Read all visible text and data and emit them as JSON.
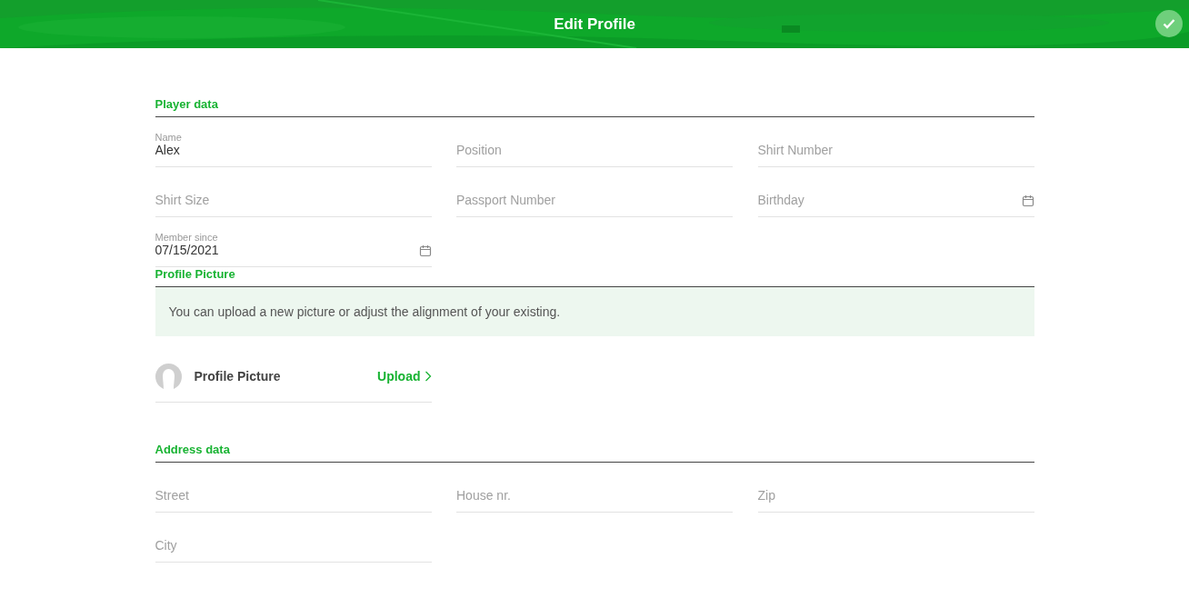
{
  "header": {
    "title": "Edit Profile"
  },
  "sections": [
    {
      "kind": "fields",
      "title": "Player data",
      "fields": [
        {
          "kind": "text",
          "label": "Name",
          "value": "Alex"
        },
        {
          "kind": "text",
          "placeholder": "Position"
        },
        {
          "kind": "text",
          "placeholder": "Shirt Number"
        },
        {
          "kind": "text",
          "placeholder": "Shirt Size"
        },
        {
          "kind": "text",
          "placeholder": "Passport Number"
        },
        {
          "kind": "date",
          "placeholder": "Birthday"
        },
        {
          "kind": "date",
          "label": "Member since",
          "value": "07/15/2021"
        }
      ]
    },
    {
      "kind": "picture",
      "title": "Profile Picture",
      "note": "You can upload a new picture or adjust the alignment of your existing.",
      "label": "Profile Picture",
      "action": "Upload"
    },
    {
      "kind": "fields",
      "title": "Address data",
      "fields": [
        {
          "kind": "text",
          "placeholder": "Street"
        },
        {
          "kind": "text",
          "placeholder": "House nr."
        },
        {
          "kind": "text",
          "placeholder": "Zip"
        },
        {
          "kind": "text",
          "placeholder": "City"
        }
      ]
    }
  ]
}
